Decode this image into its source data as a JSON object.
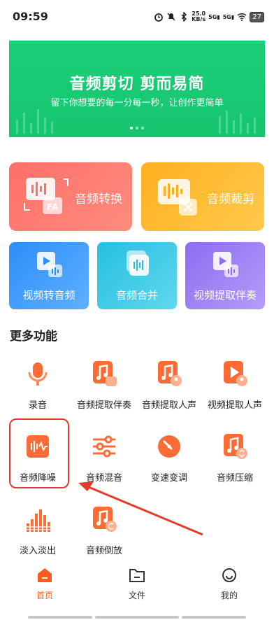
{
  "status": {
    "time": "09:59",
    "net_speed_value": "25.0",
    "net_speed_unit": "KB/s",
    "signal1": "5G",
    "signal2": "5G",
    "battery": "27"
  },
  "banner": {
    "title": "音频剪切 剪而易简",
    "subtitle": "留下你想要的每一分每一秒，让创作更简单"
  },
  "big_cards": [
    {
      "label": "音频转换",
      "color": "#ff7a70"
    },
    {
      "label": "音频裁剪",
      "color": "#ffb52e"
    }
  ],
  "mid_cards": [
    {
      "label": "视频转音频",
      "color": "#3a95f8"
    },
    {
      "label": "音频合并",
      "color": "#33c6e4"
    },
    {
      "label": "视频提取伴奏",
      "color": "#9b7df3"
    }
  ],
  "section_title": "更多功能",
  "features": [
    {
      "label": "录音",
      "icon": "microphone-icon"
    },
    {
      "label": "音频提取伴奏",
      "icon": "music-extract-icon"
    },
    {
      "label": "音频提取人声",
      "icon": "voice-extract-icon"
    },
    {
      "label": "视频提取人声",
      "icon": "video-voice-icon"
    },
    {
      "label": "音频降噪",
      "icon": "noise-reduce-icon"
    },
    {
      "label": "音频混音",
      "icon": "mixer-icon"
    },
    {
      "label": "变速变调",
      "icon": "speed-pitch-icon"
    },
    {
      "label": "音频压缩",
      "icon": "compress-icon"
    },
    {
      "label": "淡入淡出",
      "icon": "fade-icon"
    },
    {
      "label": "音频倒放",
      "icon": "reverse-icon"
    }
  ],
  "tabs": [
    {
      "label": "首页",
      "icon": "home-icon"
    },
    {
      "label": "文件",
      "icon": "folder-icon"
    },
    {
      "label": "我的",
      "icon": "profile-icon"
    }
  ],
  "colors": {
    "accent": "#ff5a1f",
    "annotation": "#e53b2c",
    "banner": "#1bd07a"
  }
}
